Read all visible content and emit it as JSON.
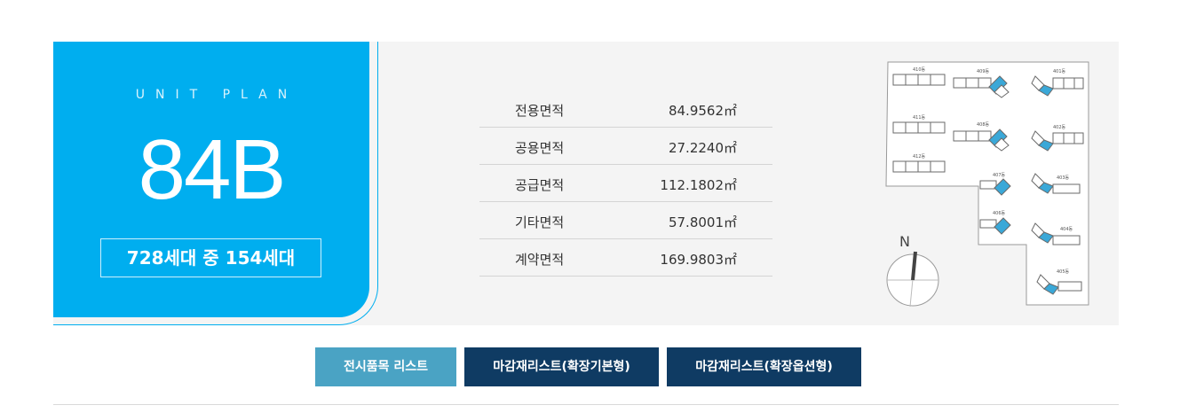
{
  "unit": {
    "plan_label": "UNIT PLAN",
    "type": "84B",
    "households": "728세대 중 154세대"
  },
  "areas": [
    {
      "label": "전용면적",
      "value": "84.9562㎡"
    },
    {
      "label": "공용면적",
      "value": "27.2240㎡"
    },
    {
      "label": "공급면적",
      "value": "112.1802㎡"
    },
    {
      "label": "기타면적",
      "value": "57.8001㎡"
    },
    {
      "label": "계약면적",
      "value": "169.9803㎡"
    }
  ],
  "site_map": {
    "compass_label": "N",
    "buildings": [
      "410동",
      "409동",
      "401동",
      "411동",
      "408동",
      "402동",
      "412동",
      "407동",
      "403동",
      "406동",
      "404동",
      "405동"
    ]
  },
  "buttons": {
    "exhibit": "전시품목 리스트",
    "finish_basic": "마감재리스트(확장기본형)",
    "finish_option": "마감재리스트(확장옵션형)"
  },
  "colors": {
    "accent": "#00aeef",
    "button_light": "#4aa3c4",
    "button_dark": "#0f3b63",
    "panel": "#f4f4f4"
  }
}
